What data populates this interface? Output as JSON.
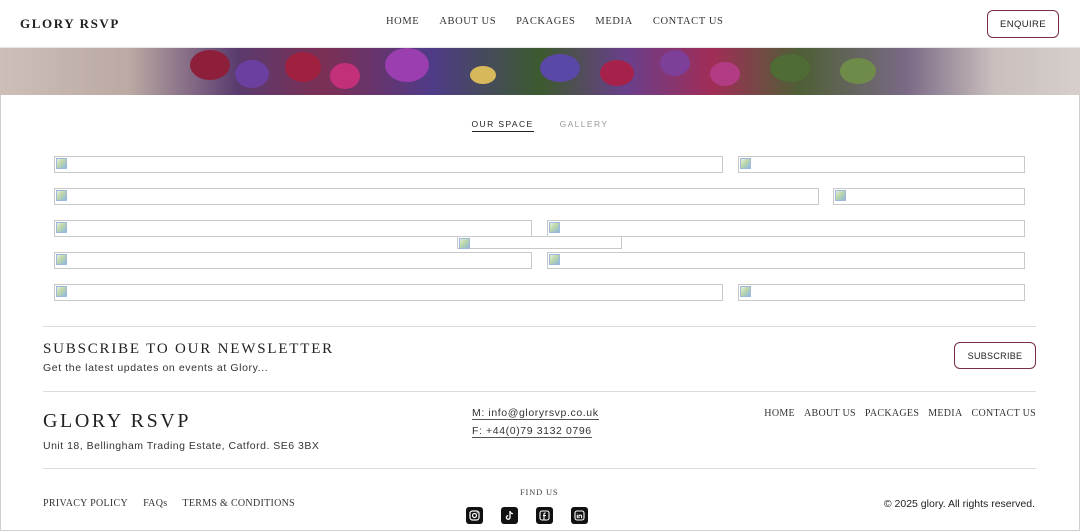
{
  "header": {
    "brand": "GLORY RSVP",
    "nav": [
      "HOME",
      "ABOUT US",
      "PACKAGES",
      "MEDIA",
      "CONTACT US"
    ],
    "enquire_label": "ENQUIRE"
  },
  "tabs": {
    "active": "OUR SPACE",
    "inactive": "GALLERY"
  },
  "gallery": {
    "image_count": 11
  },
  "newsletter": {
    "title": "SUBSCRIBE TO OUR NEWSLETTER",
    "subtitle": "Get the latest updates on events at Glory...",
    "button_label": "SUBSCRIBE"
  },
  "footer": {
    "brand": "GLORY RSVP",
    "address": "Unit 18, Bellingham Trading Estate, Catford. SE6 3BX",
    "email": "M: info@gloryrsvp.co.uk",
    "phone": "F: +44(0)79 3132 0796",
    "nav": [
      "HOME",
      "ABOUT US",
      "PACKAGES",
      "MEDIA",
      "CONTACT US"
    ],
    "legal": [
      "PRIVACY POLICY",
      "FAQs",
      "TERMS & CONDITIONS"
    ],
    "find_us": "FIND US",
    "socials": [
      "instagram-icon",
      "tiktok-icon",
      "facebook-icon",
      "linkedin-icon"
    ],
    "copyright": "© 2025 glory. All rights reserved."
  },
  "colors": {
    "accent_border": "#7a2e46",
    "divider": "#dcdcdc"
  }
}
